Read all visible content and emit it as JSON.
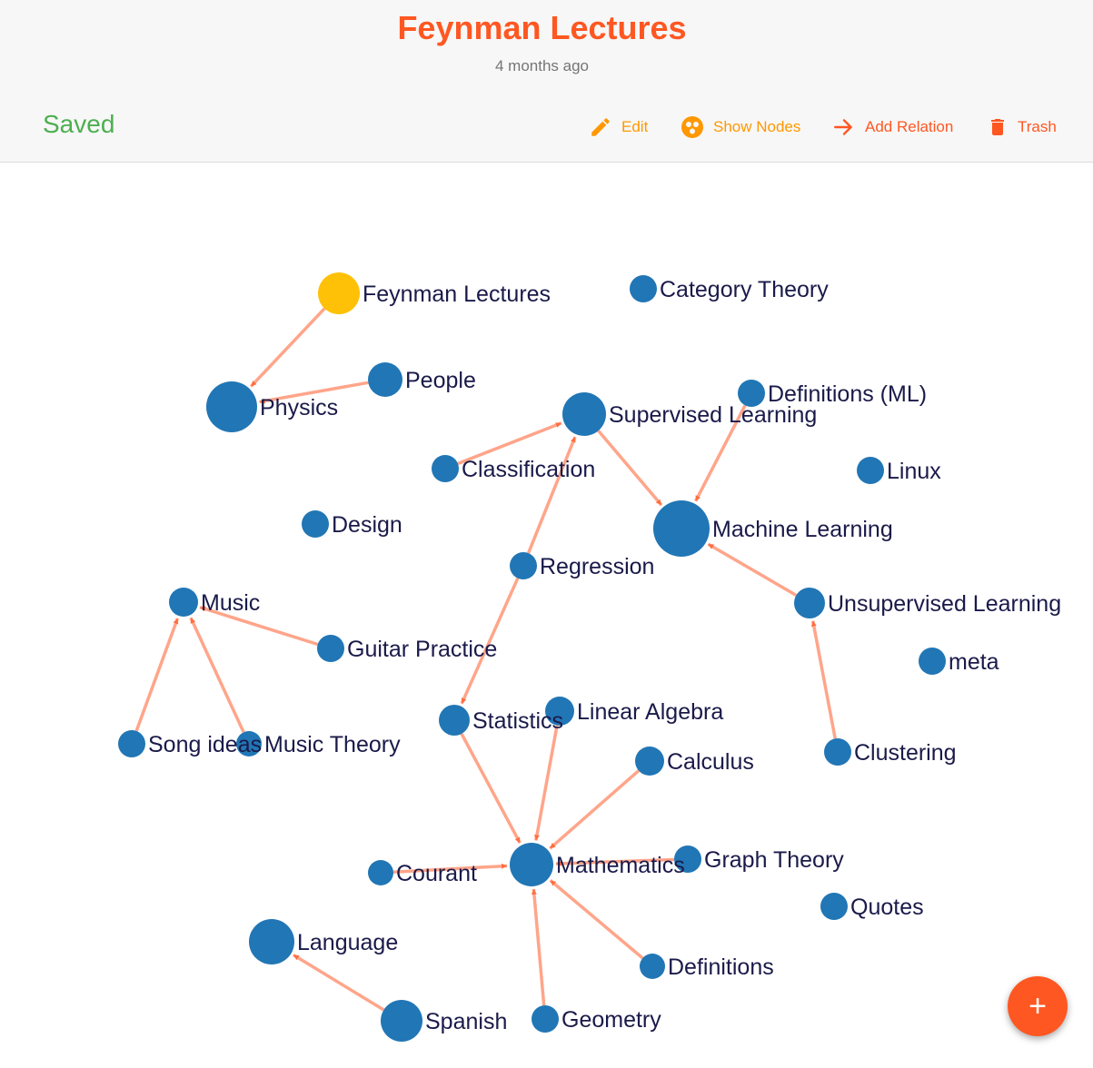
{
  "header": {
    "title": "Feynman Lectures",
    "subtitle": "4 months ago",
    "status": "Saved"
  },
  "toolbar": {
    "edit_label": "Edit",
    "show_nodes_label": "Show Nodes",
    "add_relation_label": "Add Relation",
    "trash_label": "Trash"
  },
  "fab": {
    "label": "+"
  },
  "colors": {
    "accent": "#ff5722",
    "secondary": "#ff9800",
    "saved": "#4caf50",
    "node": "#2176b5",
    "node_current": "#ffc107",
    "edge": "#ffa58a",
    "arrow": "#ff6e40",
    "label": "#1a1a4a"
  },
  "graph": {
    "current_node": "Feynman Lectures",
    "nodes": [
      "Feynman Lectures",
      "Category Theory",
      "People",
      "Physics",
      "Definitions (ML)",
      "Supervised Learning",
      "Classification",
      "Linux",
      "Design",
      "Machine Learning",
      "Regression",
      "Music",
      "Unsupervised Learning",
      "Guitar Practice",
      "meta",
      "Linear Algebra",
      "Statistics",
      "Song ideas",
      "Music Theory",
      "Clustering",
      "Calculus",
      "Graph Theory",
      "Courant",
      "Mathematics",
      "Quotes",
      "Language",
      "Definitions",
      "Spanish",
      "Geometry"
    ],
    "edges": [
      [
        "Feynman Lectures",
        "Physics"
      ],
      [
        "People",
        "Physics"
      ],
      [
        "Classification",
        "Supervised Learning"
      ],
      [
        "Regression",
        "Supervised Learning"
      ],
      [
        "Supervised Learning",
        "Machine Learning"
      ],
      [
        "Definitions (ML)",
        "Machine Learning"
      ],
      [
        "Unsupervised Learning",
        "Machine Learning"
      ],
      [
        "Clustering",
        "Unsupervised Learning"
      ],
      [
        "Regression",
        "Statistics"
      ],
      [
        "Statistics",
        "Mathematics"
      ],
      [
        "Linear Algebra",
        "Mathematics"
      ],
      [
        "Calculus",
        "Mathematics"
      ],
      [
        "Graph Theory",
        "Mathematics"
      ],
      [
        "Courant",
        "Mathematics"
      ],
      [
        "Definitions",
        "Mathematics"
      ],
      [
        "Geometry",
        "Mathematics"
      ],
      [
        "Guitar Practice",
        "Music"
      ],
      [
        "Song ideas",
        "Music"
      ],
      [
        "Music Theory",
        "Music"
      ],
      [
        "Spanish",
        "Language"
      ]
    ]
  }
}
